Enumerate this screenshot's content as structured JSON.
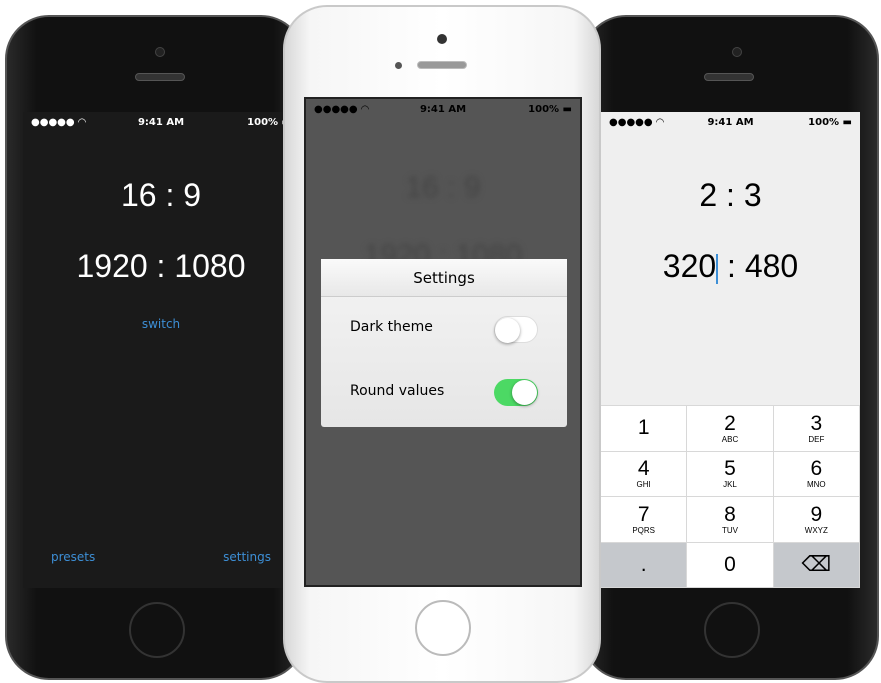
{
  "status": {
    "time": "9:41 AM",
    "battery": "100%"
  },
  "left": {
    "ratio": "16 : 9",
    "resolution": "1920 : 1080",
    "switch_label": "switch",
    "presets_label": "presets",
    "settings_label": "settings"
  },
  "middle": {
    "bg_ratio": "16 : 9",
    "bg_resolution": "1920 : 1080",
    "dialog_title": "Settings",
    "options": [
      {
        "label": "Dark theme",
        "on": false
      },
      {
        "label": "Round values",
        "on": true
      }
    ]
  },
  "right": {
    "ratio": "2 : 3",
    "width_value": "320",
    "separator": ":",
    "height_value": "480",
    "keys": [
      {
        "n": "1",
        "l": ""
      },
      {
        "n": "2",
        "l": "ABC"
      },
      {
        "n": "3",
        "l": "DEF"
      },
      {
        "n": "4",
        "l": "GHI"
      },
      {
        "n": "5",
        "l": "JKL"
      },
      {
        "n": "6",
        "l": "MNO"
      },
      {
        "n": "7",
        "l": "PQRS"
      },
      {
        "n": "8",
        "l": "TUV"
      },
      {
        "n": "9",
        "l": "WXYZ"
      },
      {
        "n": ".",
        "l": ""
      },
      {
        "n": "0",
        "l": ""
      },
      {
        "n": "⌫",
        "l": ""
      }
    ]
  },
  "colors": {
    "accent": "#3d8fd6",
    "toggle_on": "#4cd964"
  }
}
